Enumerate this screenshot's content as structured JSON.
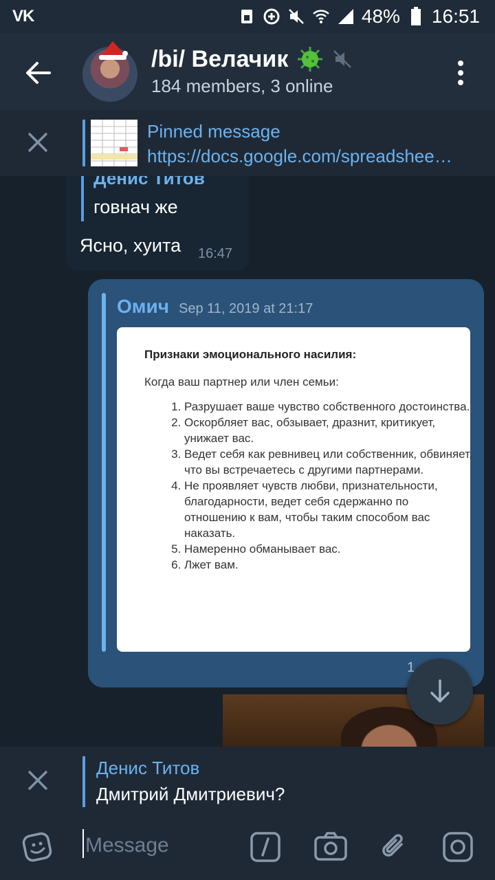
{
  "status_bar": {
    "app_icon": "vk-icon",
    "battery": "48%",
    "time": "16:51",
    "vk_label": "VK"
  },
  "header": {
    "title": "/bi/ Велачик",
    "subtitle": "184 members, 3 online",
    "icons": [
      "back-arrow-icon",
      "virus-emoji-icon",
      "muted-icon",
      "more-vertical-icon"
    ]
  },
  "pinned": {
    "label": "Pinned message",
    "text": "https://docs.google.com/spreadshee…"
  },
  "messages": {
    "incoming": {
      "quote_name": "Денис Титов",
      "quote_text": "говнач же",
      "text": "Ясно, хуита",
      "time": "16:47"
    },
    "outgoing": {
      "forward_name": "Омич",
      "forward_date": "Sep 11, 2019 at 21:17",
      "card_title": "Признаки эмоционального насилия:",
      "card_intro": "Когда ваш партнер или член семьи:",
      "card_items": [
        "Разрушает ваше чувство собственного достоинства.",
        "Оскорбляет вас, обзывает, дразнит, критикует, унижает вас.",
        "Ведет себя как ревнивец или собственник, обвиняет, что вы встречаетесь с другими партнерами.",
        "Не проявляет чувств любви, признательности, благодарности, ведет себя сдержанно по отношению к вам, чтобы таким способом вас наказать.",
        "Намеренно обманывает вас.",
        "Лжет вам."
      ],
      "time_partial": "1"
    }
  },
  "reply": {
    "name": "Денис Титов",
    "text": "Дмитрий Дмитриевич?"
  },
  "input": {
    "placeholder": "Message"
  },
  "colors": {
    "bg": "#17212b",
    "header": "#232e3c",
    "accent": "#6cb2ee",
    "outgoing": "#2b5278",
    "incoming": "#182533"
  }
}
